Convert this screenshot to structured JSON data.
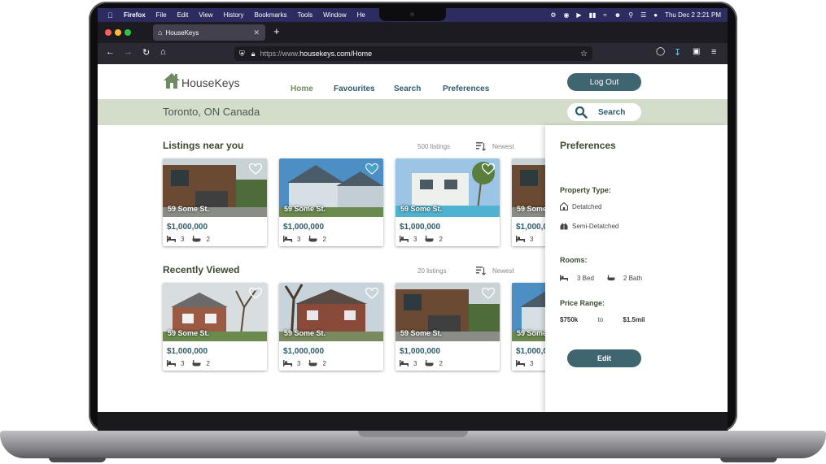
{
  "menubar": {
    "app": "Firefox",
    "items": [
      "File",
      "Edit",
      "View",
      "History",
      "Bookmarks",
      "Tools",
      "Window",
      "He"
    ],
    "clock": "Thu Dec 2  2:21 PM"
  },
  "browser": {
    "tab_title": "HouseKeys",
    "url_prefix": "https://www.",
    "url_main": "housekeys.com/Home"
  },
  "site": {
    "logo_text": "HouseKeys",
    "nav": [
      "Home",
      "Favourites",
      "Search",
      "Preferences"
    ],
    "logout_label": "Log Out",
    "location": "Toronto, ON Canada",
    "search_label": "Search"
  },
  "sections": {
    "nearby": {
      "title": "Listings near you",
      "count": "500 listings",
      "sort": "Newest"
    },
    "recent": {
      "title": "Recently Viewed",
      "count": "20 listings",
      "sort": "Newest"
    }
  },
  "listing": {
    "address": "59 Some St.",
    "price": "$1,000,000",
    "beds": "3",
    "baths": "2"
  },
  "preferences": {
    "title": "Preferences",
    "property_type_label": "Property Type:",
    "types": [
      "Detatched",
      "Semi-Detatched"
    ],
    "rooms_label": "Rooms:",
    "beds": "3 Bed",
    "baths": "2 Bath",
    "price_label": "Price Range:",
    "price_min": "$750k",
    "price_to": "to",
    "price_max": "$1.5mil",
    "edit_label": "Edit"
  },
  "colors": {
    "accent": "#3f6670",
    "nav_text": "#2e5b69",
    "nav_active": "#6f8b62",
    "location_band": "#d4dcca",
    "heart_active": "#4aa3c6"
  },
  "icons": {
    "heart": "heart-icon",
    "bed": "bed-icon",
    "bath": "bath-icon",
    "search": "magnifier-icon",
    "sort": "sort-icon"
  }
}
